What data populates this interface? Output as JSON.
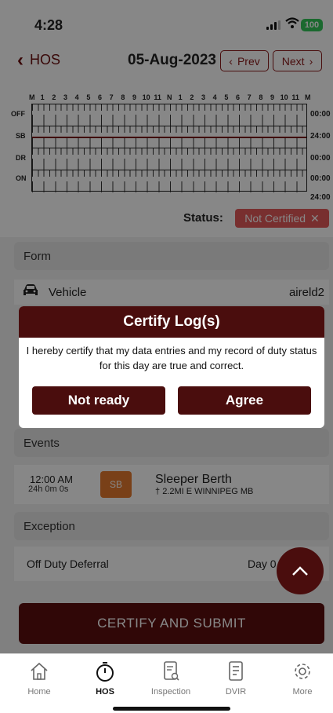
{
  "status_bar": {
    "time": "4:28",
    "battery": "100"
  },
  "nav": {
    "back_label": "HOS",
    "date": "05-Aug-2023",
    "prev_label": "Prev",
    "next_label": "Next"
  },
  "chart": {
    "hour_labels": [
      "M",
      "1",
      "2",
      "3",
      "4",
      "5",
      "6",
      "7",
      "8",
      "9",
      "10",
      "11",
      "N",
      "1",
      "2",
      "3",
      "4",
      "5",
      "6",
      "7",
      "8",
      "9",
      "10",
      "11",
      "M"
    ],
    "rows": [
      {
        "label": "OFF",
        "total": "00:00"
      },
      {
        "label": "SB",
        "total": "24:00"
      },
      {
        "label": "DR",
        "total": "00:00"
      },
      {
        "label": "ON",
        "total": "00:00"
      }
    ],
    "grand_total": "24:00"
  },
  "status": {
    "label": "Status:",
    "value": "Not Certified"
  },
  "form": {
    "header": "Form",
    "vehicle_label": "Vehicle",
    "vehicle_value": "aireld2"
  },
  "events": {
    "header": "Events",
    "items": [
      {
        "time": "12:00 AM",
        "duration": "24h 0m 0s",
        "badge": "SB",
        "title": "Sleeper Berth",
        "location": "2.2MI E WINNIPEG MB"
      }
    ]
  },
  "exception": {
    "header": "Exception",
    "label": "Off Duty Deferral",
    "value": "Day 0"
  },
  "certify_button": "CERTIFY AND SUBMIT",
  "modal": {
    "title": "Certify Log(s)",
    "text": "I hereby certify that my data entries and my record of duty status for this day are true and correct.",
    "not_ready": "Not ready",
    "agree": "Agree"
  },
  "tabs": [
    {
      "label": "Home",
      "icon": "home-icon"
    },
    {
      "label": "HOS",
      "icon": "stopwatch-icon",
      "active": true
    },
    {
      "label": "Inspection",
      "icon": "inspection-icon"
    },
    {
      "label": "DVIR",
      "icon": "document-icon"
    },
    {
      "label": "More",
      "icon": "gear-icon"
    }
  ],
  "colors": {
    "accent": "#4a0d0d",
    "status_badge": "#e35a5a",
    "event_badge": "#e57a2e",
    "battery": "#34c759"
  }
}
